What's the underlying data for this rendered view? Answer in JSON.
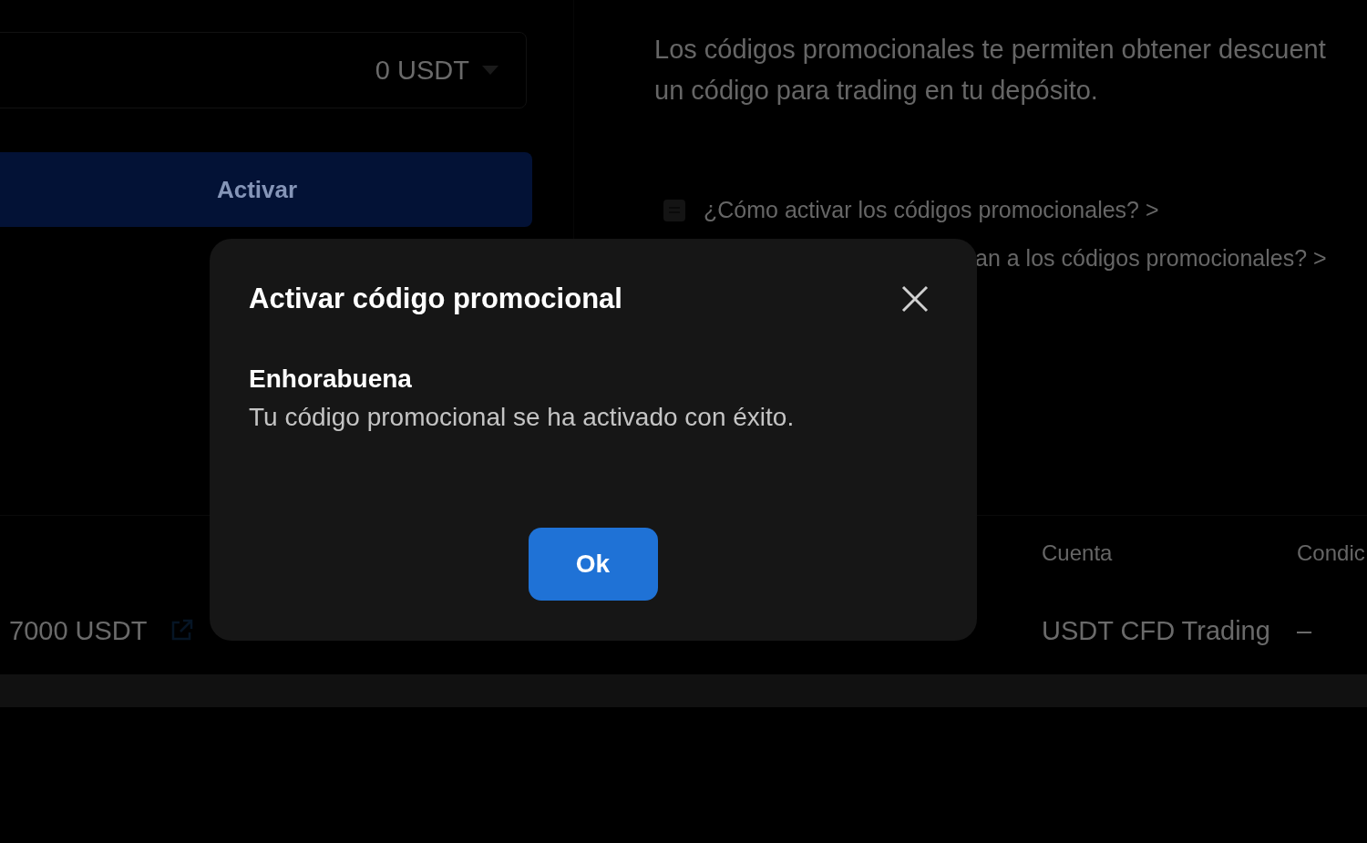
{
  "amount_field": {
    "value": "0 USDT"
  },
  "activate_button": {
    "label": "Activar"
  },
  "description": [
    "Los códigos promocionales te permiten obtener descuent",
    "un código para trading en tu depósito."
  ],
  "help_links": [
    {
      "kind": "with-icon",
      "text": "¿Cómo activar los códigos promocionales? >"
    },
    {
      "kind": "cut",
      "text": "an a los códigos promocionales? >"
    }
  ],
  "table": {
    "columns": [
      "Cuenta",
      "Condic"
    ],
    "rows": [
      {
        "amount": "7000 USDT",
        "account": "USDT CFD Trading",
        "conditions": "–"
      }
    ]
  },
  "dialog": {
    "title": "Activar código promocional",
    "heading": "Enhorabuena",
    "message": "Tu código promocional se ha activado con éxito.",
    "button": "Ok"
  }
}
